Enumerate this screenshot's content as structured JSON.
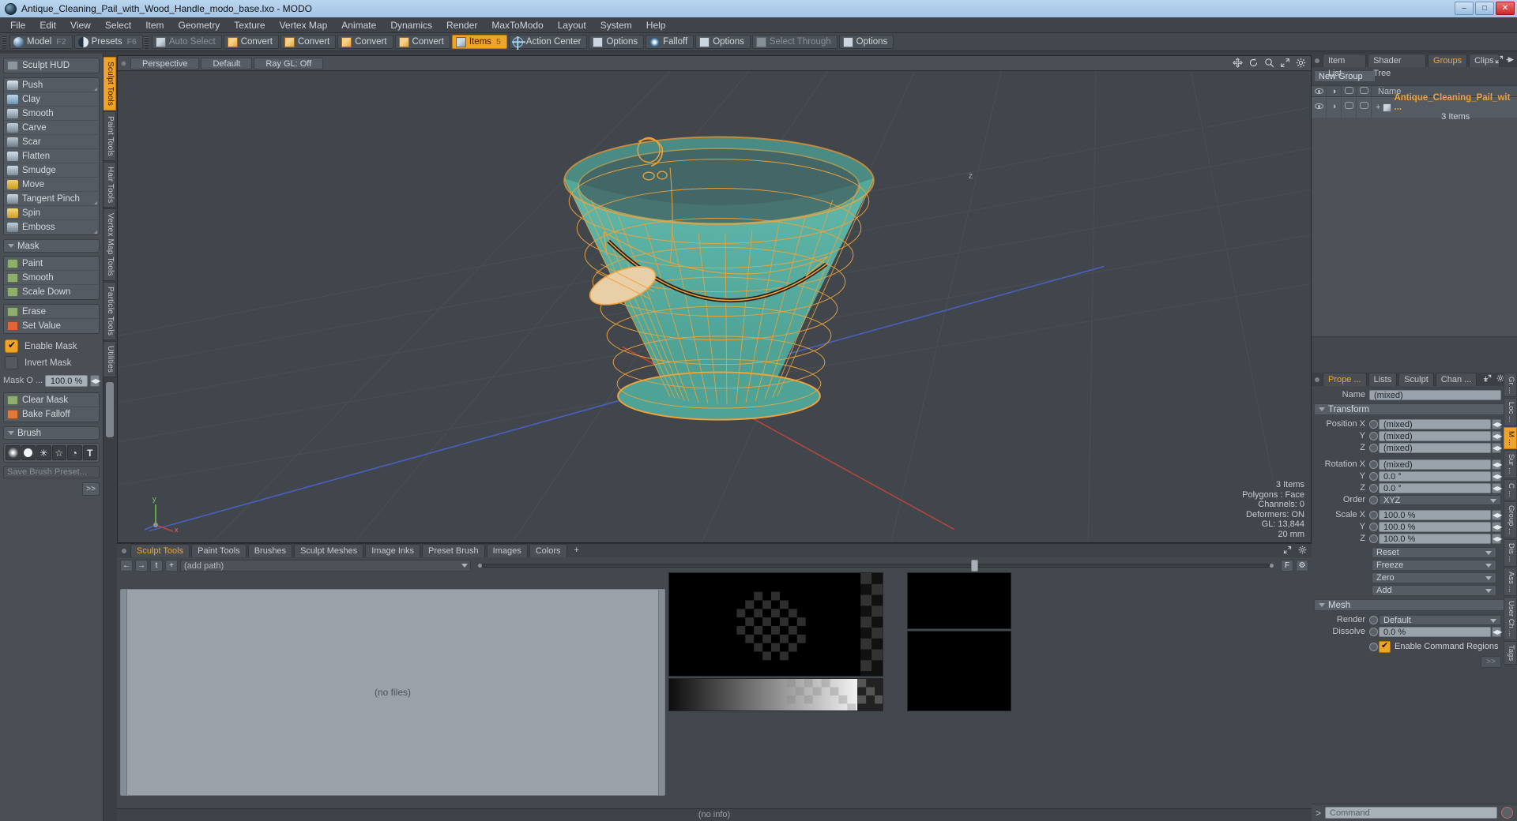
{
  "window": {
    "title": "Antique_Cleaning_Pail_with_Wood_Handle_modo_base.lxo - MODO",
    "minimize": "–",
    "maximize": "□",
    "close": "✕"
  },
  "menu": [
    "File",
    "Edit",
    "View",
    "Select",
    "Item",
    "Geometry",
    "Texture",
    "Vertex Map",
    "Animate",
    "Dynamics",
    "Render",
    "MaxToModo",
    "Layout",
    "System",
    "Help"
  ],
  "modebar": {
    "model": "Model",
    "model_key": "F2",
    "presets": "Presets",
    "presets_key": "F6",
    "auto_select": "Auto Select",
    "convert1": "Convert",
    "convert2": "Convert",
    "convert3": "Convert",
    "convert4": "Convert",
    "items": "Items",
    "items_key": "5",
    "action_center": "Action Center",
    "options1": "Options",
    "falloff": "Falloff",
    "options2": "Options",
    "select_through": "Select Through",
    "options3": "Options"
  },
  "vtabs": [
    {
      "label": "Sculpt Tools",
      "active": true
    },
    {
      "label": "Paint Tools",
      "active": false
    },
    {
      "label": "Hair Tools",
      "active": false
    },
    {
      "label": "Vertex Map Tools",
      "active": false
    },
    {
      "label": "Particle Tools",
      "active": false
    },
    {
      "label": "Utilities",
      "active": false
    }
  ],
  "left_panel": {
    "hud_button": "Sculpt HUD",
    "tools": [
      {
        "label": "Push",
        "color": "#b8c6d2",
        "corner": true
      },
      {
        "label": "Clay",
        "color": "#9ec4dd",
        "corner": false
      },
      {
        "label": "Smooth",
        "color": "#a9b7c4",
        "corner": false
      },
      {
        "label": "Carve",
        "color": "#9fb0be",
        "corner": false
      },
      {
        "label": "Scar",
        "color": "#98a9b8",
        "corner": false
      },
      {
        "label": "Flatten",
        "color": "#b6c4d0",
        "corner": false
      },
      {
        "label": "Smudge",
        "color": "#aebdc9",
        "corner": false
      },
      {
        "label": "Move",
        "color": "#d8b23e",
        "corner": false
      },
      {
        "label": "Tangent Pinch",
        "color": "#b0bfcb",
        "corner": true
      },
      {
        "label": "Spin",
        "color": "#e0b33c",
        "corner": false
      },
      {
        "label": "Emboss",
        "color": "#9cadbb",
        "corner": true
      }
    ],
    "mask_section": "Mask",
    "mask_tools": [
      {
        "label": "Paint",
        "color": "#e0663a"
      },
      {
        "label": "Smooth",
        "color": "#8fae6d"
      },
      {
        "label": "Scale Down",
        "color": "#8fae6d"
      }
    ],
    "mask_tools2": [
      {
        "label": "Erase",
        "color": "#8fae6d"
      },
      {
        "label": "Set Value",
        "color": "#e0663a"
      }
    ],
    "enable_mask": "Enable Mask",
    "enable_mask_checked": true,
    "invert_mask": "Invert Mask",
    "invert_mask_checked": false,
    "mask_opacity_label": "Mask O ...",
    "mask_opacity_value": "100.0 %",
    "mask_tools3": [
      {
        "label": "Clear Mask",
        "color": "#8fae6d"
      },
      {
        "label": "Bake Falloff",
        "color": "#e07a3a"
      }
    ],
    "brush_section": "Brush",
    "brush_icons": [
      "soft-round-brush",
      "hard-round-brush",
      "spatter-brush",
      "star-brush",
      "custom-shape-brush",
      "text-brush"
    ],
    "save_preset_placeholder": "Save Brush Preset...",
    "more_button": ">>"
  },
  "viewport": {
    "dot": "",
    "perspective": "Perspective",
    "shading": "Default",
    "raygl": "Ray GL: Off",
    "icons": [
      "move-icon",
      "rotate-icon",
      "zoom-icon",
      "maximize-icon",
      "gear-icon"
    ],
    "stats": [
      "3 Items",
      "Polygons : Face",
      "Channels: 0",
      "Deformers: ON",
      "GL: 13,844",
      "20 mm"
    ],
    "axis_labels": {
      "x": "x",
      "y": "y",
      "z": "z"
    }
  },
  "bottom_panel": {
    "tabs": [
      {
        "label": "Sculpt Tools",
        "active": true
      },
      {
        "label": "Paint Tools",
        "active": false
      },
      {
        "label": "Brushes",
        "active": false
      },
      {
        "label": "Sculpt Meshes",
        "active": false
      },
      {
        "label": "Image Inks",
        "active": false
      },
      {
        "label": "Preset Brush",
        "active": false
      },
      {
        "label": "Images",
        "active": false
      },
      {
        "label": "Colors",
        "active": false
      }
    ],
    "add_tab": "+",
    "nav_back": "←",
    "nav_forward": "→",
    "nav_up": "t",
    "nav_add": "+",
    "path_value": "(add path)",
    "filter_label": "F",
    "no_files": "(no files)",
    "no_info": "(no info)"
  },
  "right_panel": {
    "top_tabs": [
      {
        "label": "Item List",
        "active": false
      },
      {
        "label": "Shader Tree",
        "active": false
      },
      {
        "label": "Groups",
        "active": true
      },
      {
        "label": "Clips",
        "active": false
      }
    ],
    "add_tab": "+",
    "new_group": "New Group",
    "list_header": {
      "name": "Name"
    },
    "list_rows": [
      {
        "name": "Antique_Cleaning_Pail_wit ...",
        "sub": "3 Items",
        "expand": "+"
      }
    ],
    "prop_tabs": [
      {
        "label": "Prope ...",
        "active": true
      },
      {
        "label": "Lists",
        "active": false
      },
      {
        "label": "Sculpt",
        "active": false
      },
      {
        "label": "Chan ...",
        "active": false
      }
    ],
    "name_label": "Name",
    "name_value": "(mixed)",
    "transform_section": "Transform",
    "transform_rows": [
      {
        "label": "Position X",
        "value": "(mixed)"
      },
      {
        "label": "Y",
        "value": "(mixed)"
      },
      {
        "label": "Z",
        "value": "(mixed)"
      },
      {
        "label": "Rotation X",
        "value": "(mixed)"
      },
      {
        "label": "Y",
        "value": "0.0 °"
      },
      {
        "label": "Z",
        "value": "0.0 °"
      }
    ],
    "order_label": "Order",
    "order_value": "XYZ",
    "scale_rows": [
      {
        "label": "Scale X",
        "value": "100.0 %"
      },
      {
        "label": "Y",
        "value": "100.0 %"
      },
      {
        "label": "Z",
        "value": "100.0 %"
      }
    ],
    "action_dropdowns": [
      "Reset",
      "Freeze",
      "Zero",
      "Add"
    ],
    "mesh_section": "Mesh",
    "render_label": "Render",
    "render_value": "Default",
    "dissolve_label": "Dissolve",
    "dissolve_value": "0.0 %",
    "enable_command_regions": "Enable Command Regions",
    "enable_command_regions_checked": true,
    "more_button": ">>",
    "side_tabs": [
      {
        "label": "Gr ...",
        "active": false
      },
      {
        "label": "Loc ...",
        "active": false
      },
      {
        "label": "M ...",
        "active": true
      },
      {
        "label": "Sur ...",
        "active": false
      },
      {
        "label": "C ...",
        "active": false
      },
      {
        "label": "Group ...",
        "active": false
      },
      {
        "label": "Dis ...",
        "active": false
      },
      {
        "label": "Ass ...",
        "active": false
      },
      {
        "label": "User Ch ...",
        "active": false
      },
      {
        "label": "Tags",
        "active": false
      }
    ],
    "command_prompt": ">",
    "command_placeholder": "Command"
  },
  "colors": {
    "accent": "#f0a32a",
    "mesh_fill": "#57b4a6",
    "wire_orange": "#f0a33a",
    "panel_bg": "#43484e",
    "viewport_bg": "#41464c",
    "title_bar": "#a4c4e4"
  }
}
